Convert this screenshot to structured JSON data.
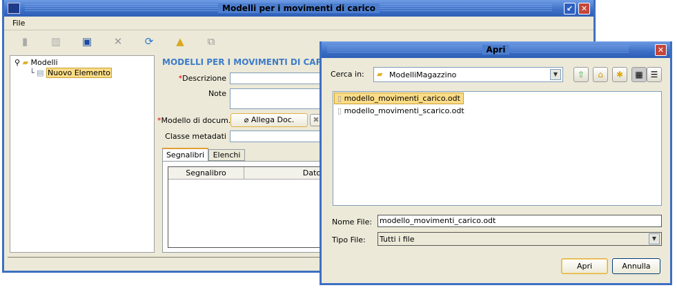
{
  "main": {
    "title": "Modelli per i movimenti di carico",
    "menu": [
      "File"
    ],
    "tree": {
      "root": "Modelli",
      "child": "Nuovo Elemento"
    },
    "section_title": "MODELLI PER I MOVIMENTI DI CARICO",
    "labels": {
      "descrizione": "Descrizione",
      "note": "Note",
      "modello": "Modello di docum.",
      "classe": "Classe metadati",
      "required": "*"
    },
    "attach_button": "Allega Doc.",
    "tabs": [
      "Segnalibri",
      "Elenchi"
    ],
    "columns": [
      "Segnalibro",
      "Dato"
    ]
  },
  "dialog": {
    "title": "Apri",
    "look_in_label": "Cerca in:",
    "look_in_value": "ModelliMagazzino",
    "files": [
      "modello_movimenti_carico.odt",
      "modello_movimenti_scarico.odt"
    ],
    "filename_label": "Nome File:",
    "filename_value": "modello_movimenti_carico.odt",
    "filetype_label": "Tipo File:",
    "filetype_value": "Tutti i file",
    "open_button": "Apri",
    "cancel_button": "Annulla"
  }
}
